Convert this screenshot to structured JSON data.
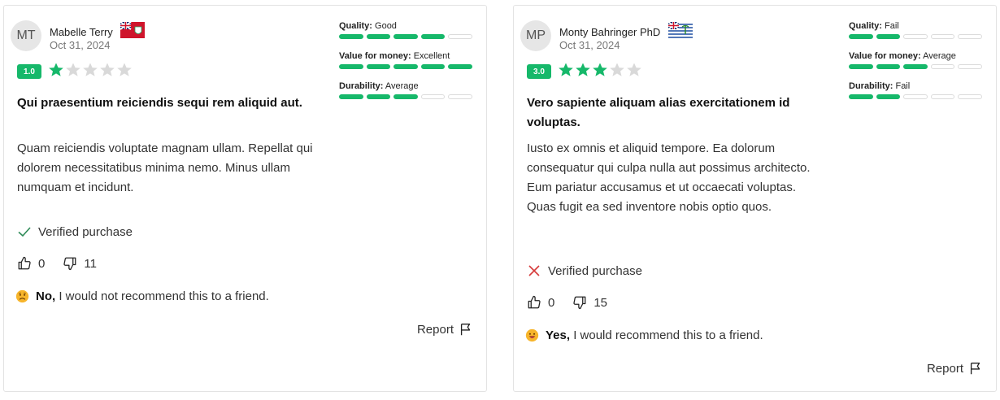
{
  "reviews": [
    {
      "initials": "MT",
      "author": "Mabelle Terry",
      "flag_icon": "bermuda-flag-icon",
      "date": "Oct 31, 2024",
      "score": "1.0",
      "rating": 1,
      "title": "Qui praesentium reiciendis sequi rem aliquid aut.",
      "body": "Quam reiciendis voluptate magnam ullam. Repellat qui dolorem necessitatibus minima nemo. Minus ullam numquam et incidunt.",
      "verified_label": "Verified purchase",
      "verified": true,
      "helpful_count": "0",
      "unhelpful_count": "11",
      "recommend_answer": "No,",
      "recommend_text": " I would not recommend this to a friend.",
      "recommend_icon": "sad-face-emoji",
      "report_label": "Report",
      "metrics": [
        {
          "label": "Quality:",
          "value": "Good",
          "level": 4
        },
        {
          "label": "Value for money:",
          "value": "Excellent",
          "level": 5
        },
        {
          "label": "Durability:",
          "value": "Average",
          "level": 3
        }
      ]
    },
    {
      "initials": "MP",
      "author": "Monty Bahringer PhD",
      "flag_icon": "british-indian-ocean-territory-flag-icon",
      "date": "Oct 31, 2024",
      "score": "3.0",
      "rating": 3,
      "title": "Vero sapiente aliquam alias exercitationem id voluptas.",
      "body": "Iusto ex omnis et aliquid tempore. Ea dolorum consequatur qui culpa nulla aut possimus architecto. Eum pariatur accusamus et ut occaecati voluptas. Quas fugit ea sed inventore nobis optio quos.",
      "verified_label": "Verified purchase",
      "verified": false,
      "helpful_count": "0",
      "unhelpful_count": "15",
      "recommend_answer": "Yes,",
      "recommend_text": " I would recommend this to a friend.",
      "recommend_icon": "happy-face-emoji",
      "report_label": "Report",
      "metrics": [
        {
          "label": "Quality:",
          "value": "Fail",
          "level": 2
        },
        {
          "label": "Value for money:",
          "value": "Average",
          "level": 3
        },
        {
          "label": "Durability:",
          "value": "Fail",
          "level": 2
        }
      ]
    }
  ],
  "colors": {
    "accent": "#16b86a",
    "star_empty": "#d9d9d9",
    "check": "#2e8b57",
    "cross": "#d63b3b"
  }
}
